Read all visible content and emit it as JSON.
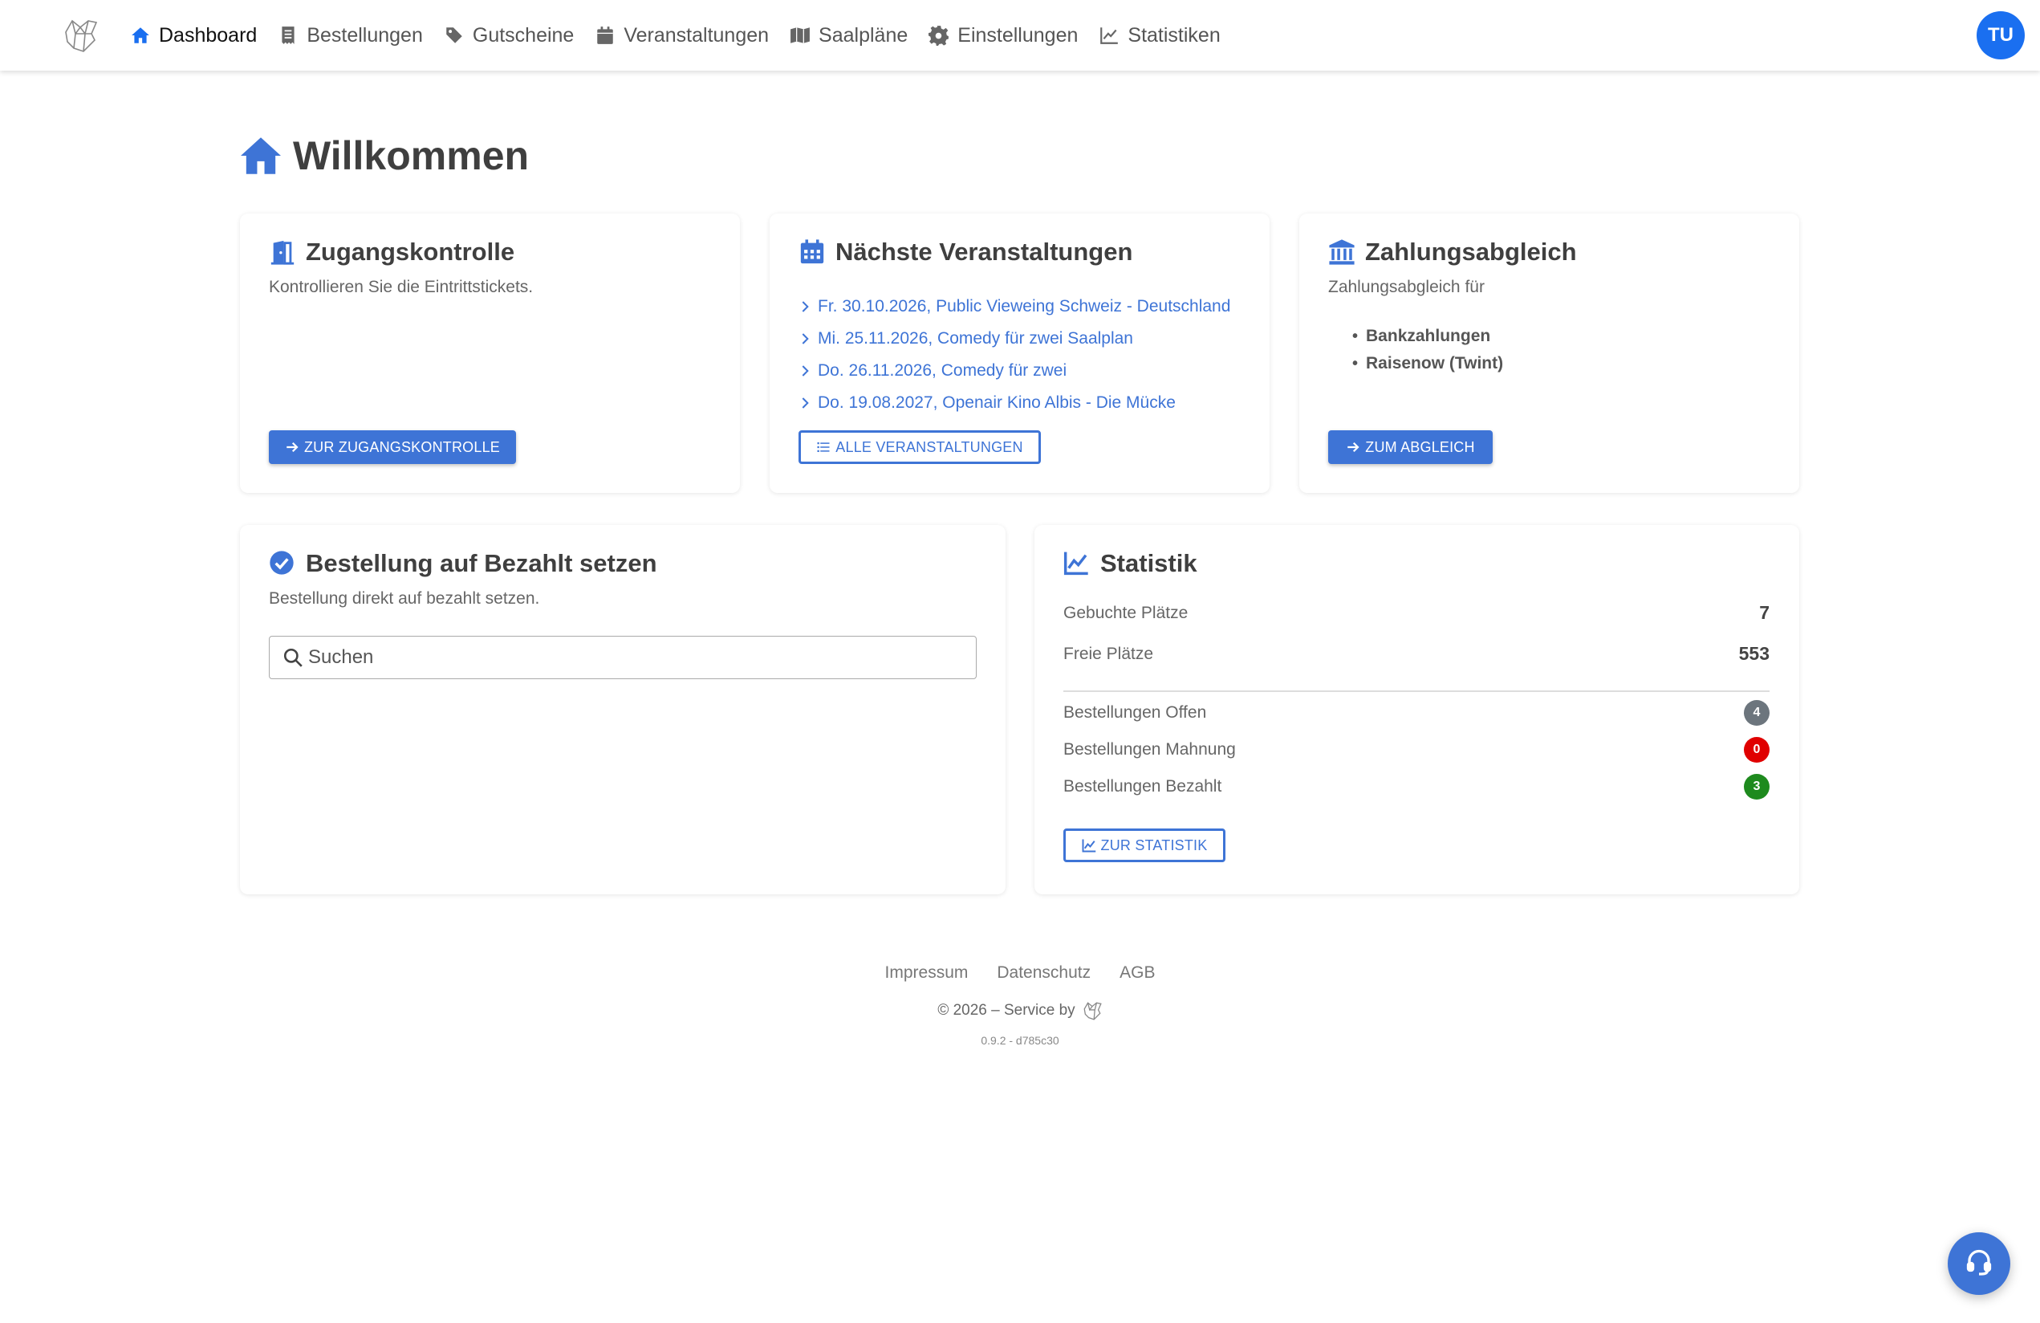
{
  "nav": {
    "logo_icon": "fox-logo-icon",
    "items": [
      {
        "label": "Dashboard",
        "icon": "home-icon"
      },
      {
        "label": "Bestellungen",
        "icon": "receipt-icon"
      },
      {
        "label": "Gutscheine",
        "icon": "tag-icon"
      },
      {
        "label": "Veranstaltungen",
        "icon": "calendar-icon"
      },
      {
        "label": "Saalpläne",
        "icon": "map-icon"
      },
      {
        "label": "Einstellungen",
        "icon": "gear-icon"
      },
      {
        "label": "Statistiken",
        "icon": "chart-line-icon"
      }
    ],
    "avatar": "TU"
  },
  "page": {
    "title": "Willkommen"
  },
  "access_card": {
    "title": "Zugangskontrolle",
    "subtitle": "Kontrollieren Sie die Eintrittstickets.",
    "button": "ZUR ZUGANGSKONTROLLE"
  },
  "events_card": {
    "title": "Nächste Veranstaltungen",
    "events": [
      "Fr. 30.10.2026, Public Vieweing Schweiz - Deutschland",
      "Mi. 25.11.2026, Comedy für zwei Saalplan",
      "Do. 26.11.2026, Comedy für zwei",
      "Do. 19.08.2027, Openair Kino Albis - Die Mücke"
    ],
    "button": "ALLE VERANSTALTUNGEN"
  },
  "payment_card": {
    "title": "Zahlungsabgleich",
    "subtitle": "Zahlungsabgleich für",
    "items": [
      "Bankzahlungen",
      "Raisenow (Twint)"
    ],
    "button": "ZUM ABGLEICH"
  },
  "paid_card": {
    "title": "Bestellung auf Bezahlt setzen",
    "subtitle": "Bestellung direkt auf bezahlt setzen.",
    "search_placeholder": "Suchen"
  },
  "stats_card": {
    "title": "Statistik",
    "booked_label": "Gebuchte Plätze",
    "booked_value": "7",
    "free_label": "Freie Plätze",
    "free_value": "553",
    "open_label": "Bestellungen Offen",
    "open_value": "4",
    "open_color": "#6c757d",
    "reminder_label": "Bestellungen Mahnung",
    "reminder_value": "0",
    "reminder_color": "#e00000",
    "paid_label": "Bestellungen Bezahlt",
    "paid_value": "3",
    "paid_color": "#1e8a1e",
    "button": "ZUR STATISTIK"
  },
  "footer": {
    "links": [
      "Impressum",
      "Datenschutz",
      "AGB"
    ],
    "copyright": "© 2026 – Service by",
    "version": "0.9.2 - d785c30"
  },
  "colors": {
    "accent": "#3e74d6",
    "nav_active": "#1a6ff0"
  }
}
